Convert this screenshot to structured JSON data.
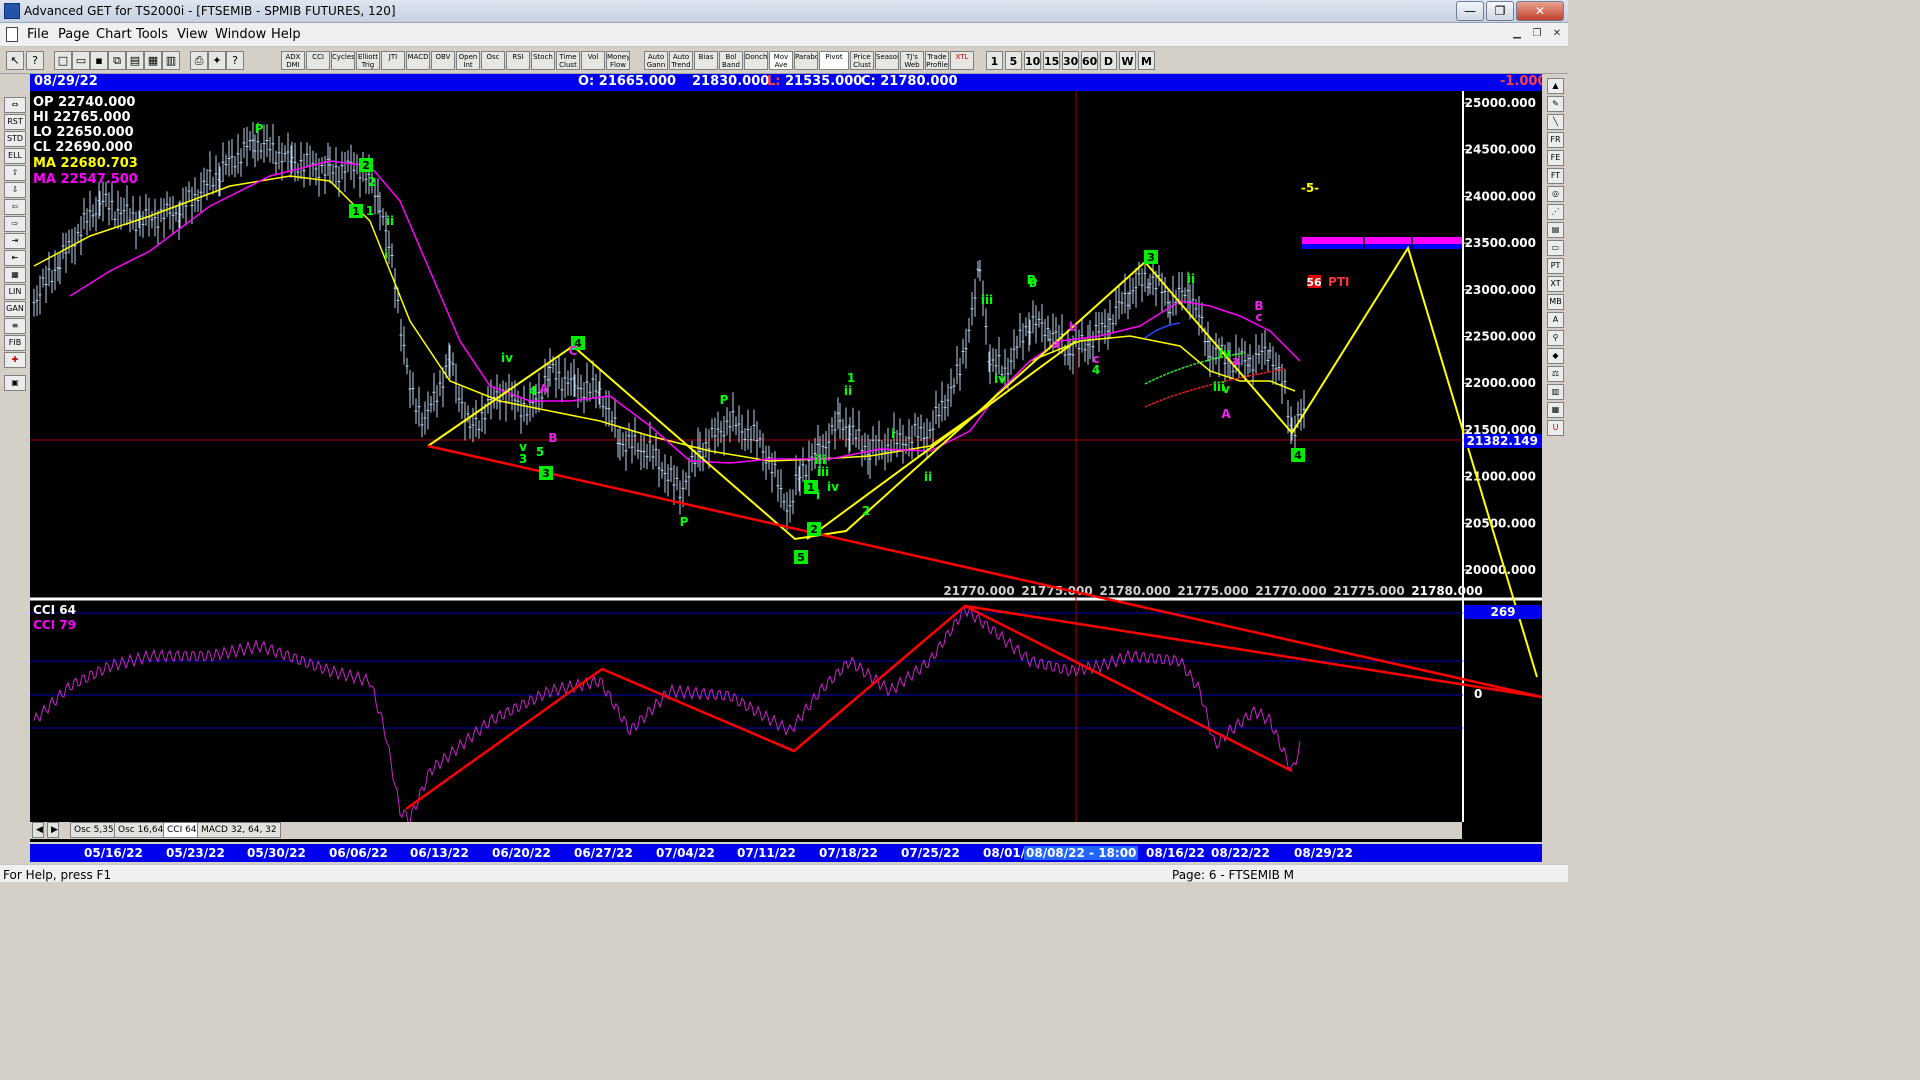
{
  "window": {
    "title": "Advanced GET for TS2000i - [FTSEMIB - SPMIB FUTURES, 120]",
    "min_label": "—",
    "max_label": "❐",
    "close_label": "✕"
  },
  "menu": [
    "File",
    "Page",
    "Chart",
    "Tools",
    "View",
    "Window",
    "Help"
  ],
  "toolbar": {
    "study_buttons": [
      "ADX DMI",
      "CCI",
      "Cycles",
      "Elliott Trig",
      "JTI",
      "MACD",
      "OBV",
      "Open Int",
      "Osc",
      "RSI",
      "Stoch",
      "Time Clust",
      "Vol",
      "Money Flow",
      "Auto Gann",
      "Auto Trend",
      "Bias",
      "Bol Band",
      "Donch",
      "Mov Ave",
      "Parabolic",
      "Pivot",
      "Price Clust",
      "Seasonals",
      "TJ's Web",
      "Trade Profile",
      "XTL"
    ],
    "interval_buttons": [
      "1",
      "5",
      "10",
      "15",
      "30",
      "60",
      "D",
      "W",
      "M"
    ]
  },
  "info": {
    "date": "08/29/22",
    "open": "O: 21665.000",
    "high": "21830.000",
    "low_label": "L:",
    "low": "21535.000",
    "close": "C: 21780.000",
    "change": "-1.000"
  },
  "ohlc": {
    "op": "OP  22740.000",
    "hi": "HI   22765.000",
    "lo": "LO  22650.000",
    "cl": "CL  22690.000",
    "ma1": "MA  22680.703",
    "ma2": "MA  22547.500"
  },
  "colors": {
    "price": "#b8d2ee",
    "ma_yellow": "#ffff00",
    "ma_magenta": "#ff00ff",
    "trend": "#ff0000",
    "label_green": "#00ff00",
    "axis_blue": "#0000ee"
  },
  "price_axis": [
    "25000.000",
    "24500.000",
    "24000.000",
    "23500.000",
    "23000.000",
    "22500.000",
    "22000.000",
    "21500.000",
    "21000.000",
    "20500.000",
    "20000.000"
  ],
  "current_price": "21382.149",
  "bottom_prices": [
    "21770.000",
    "21775.000",
    "21780.000",
    "21775.000",
    "21770.000",
    "21775.000",
    "21780.000"
  ],
  "cci": {
    "label1": "CCI 64",
    "label2": "CCI  79",
    "zero": "0",
    "reading": "269"
  },
  "tabs": [
    "Osc 5,35",
    "Osc 16,64",
    "CCI 64",
    "MACD 32, 64, 32"
  ],
  "dates": [
    "05/16/22",
    "05/23/22",
    "05/30/22",
    "06/06/22",
    "06/13/22",
    "06/20/22",
    "06/27/22",
    "07/04/22",
    "07/11/22",
    "07/18/22",
    "07/25/22",
    "08/01/",
    "08/08/22 - 18:00",
    "08/16/22",
    "08/22/22",
    "08/29/22"
  ],
  "annotations": {
    "green_boxes": [
      "2",
      "1",
      "4",
      "3",
      "1",
      "2",
      "5",
      "3",
      "4"
    ],
    "green_text": [
      "P",
      "2",
      "1",
      "ii",
      "i",
      "iv",
      "4",
      "v",
      "3",
      "5",
      "P",
      "P",
      "iii",
      "i",
      "1",
      "ii",
      "iv",
      "P",
      "iii",
      "2",
      "i",
      "ii",
      "iii",
      "3",
      "P",
      "iv",
      "4",
      "ii",
      "iv",
      "iii",
      "v"
    ],
    "magenta_text": [
      "A",
      "B",
      "C",
      "b",
      "a",
      "c",
      "a",
      "B",
      "c",
      "A"
    ],
    "yellow_text": "-5-",
    "pti_value": "56",
    "pti_label": "PTI"
  },
  "status": {
    "left": "For Help, press F1",
    "right": "Page: 6 - FTSEMIB M"
  }
}
